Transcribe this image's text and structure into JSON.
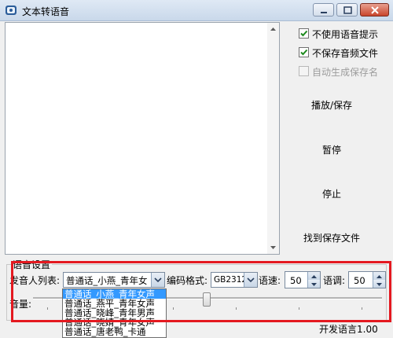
{
  "window": {
    "title": "文本转语音",
    "icon": "speaker-app-icon"
  },
  "options": {
    "no_voice_prompt": {
      "label": "不使用语音提示",
      "checked": true
    },
    "no_save_audio": {
      "label": "不保存音频文件",
      "checked": true
    },
    "auto_save_name": {
      "label": "自动生成保存名",
      "checked": false,
      "disabled": true
    }
  },
  "buttons": {
    "play_save": "播放/保存",
    "pause": "暂停",
    "stop": "停止",
    "find_saved": "找到保存文件"
  },
  "settings": {
    "group_title": "语音设置",
    "speaker_label": "发音人列表:",
    "speaker_selected": "普通话_小燕_青年女",
    "speaker_options": [
      "普通话_小燕_青年女声",
      "普通话_燕平_青年女声",
      "普通话_晓峰_青年男声",
      "普通话_晓婧_青年女声",
      "普通话_唐老鸭_卡通"
    ],
    "encoding_label": "编码格式:",
    "encoding_value": "GB2312",
    "speed_label": "语速:",
    "speed_value": "50",
    "pitch_label": "语调:",
    "pitch_value": "50",
    "volume_label": "音量:"
  },
  "footer": {
    "version": "开发语言1.00"
  }
}
